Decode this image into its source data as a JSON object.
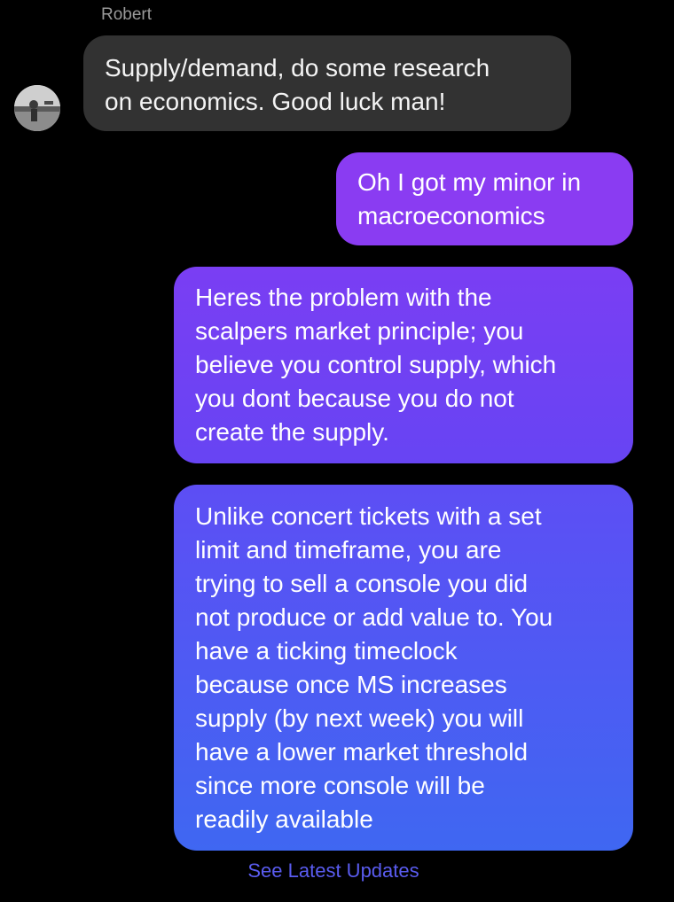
{
  "conversation": {
    "sender_name": "Robert"
  },
  "messages": [
    {
      "direction": "incoming",
      "lines": [
        "Supply/demand, do some research",
        "on economics.  Good luck man!"
      ]
    },
    {
      "direction": "outgoing",
      "lines": [
        "Oh I got my minor in",
        "macroeconomics"
      ]
    },
    {
      "direction": "outgoing",
      "lines": [
        "Heres the problem with the",
        "scalpers market principle; you",
        "believe you control supply, which",
        "you dont because you do not",
        "create the supply."
      ]
    },
    {
      "direction": "outgoing",
      "lines": [
        "Unlike concert tickets with a set",
        "limit and timeframe, you are",
        "trying to sell a console you did",
        "not produce or add value to. You",
        "have a ticking timeclock",
        "because once MS increases",
        "supply (by next week) you will",
        "have a lower market threshold",
        "since more console will be",
        "readily available"
      ]
    }
  ],
  "footer": {
    "link_label": "See Latest Updates"
  },
  "colors": {
    "background": "#000000",
    "incoming_bubble": "#323232",
    "outgoing_top": "#8a3cf2",
    "outgoing_bottom": "#3f67f2",
    "link": "#5a5cf0"
  }
}
